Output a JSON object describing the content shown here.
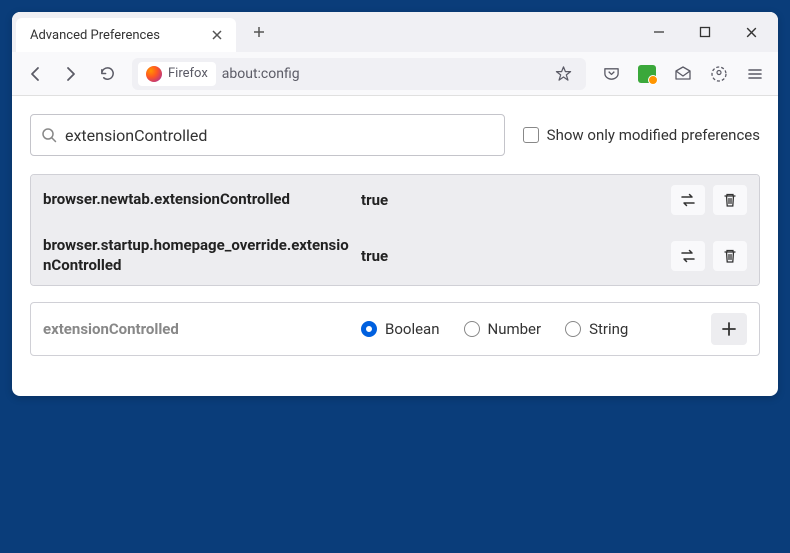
{
  "titlebar": {
    "tab_title": "Advanced Preferences"
  },
  "navbar": {
    "identity_label": "Firefox",
    "url": "about:config"
  },
  "search": {
    "value": "extensionControlled",
    "modified_only_label": "Show only modified preferences"
  },
  "prefs": [
    {
      "name": "browser.newtab.extensionControlled",
      "value": "true"
    },
    {
      "name": "browser.startup.homepage_override.extensionControlled",
      "value": "true"
    }
  ],
  "new_pref": {
    "name": "extensionControlled",
    "types": [
      "Boolean",
      "Number",
      "String"
    ],
    "selected": "Boolean"
  }
}
